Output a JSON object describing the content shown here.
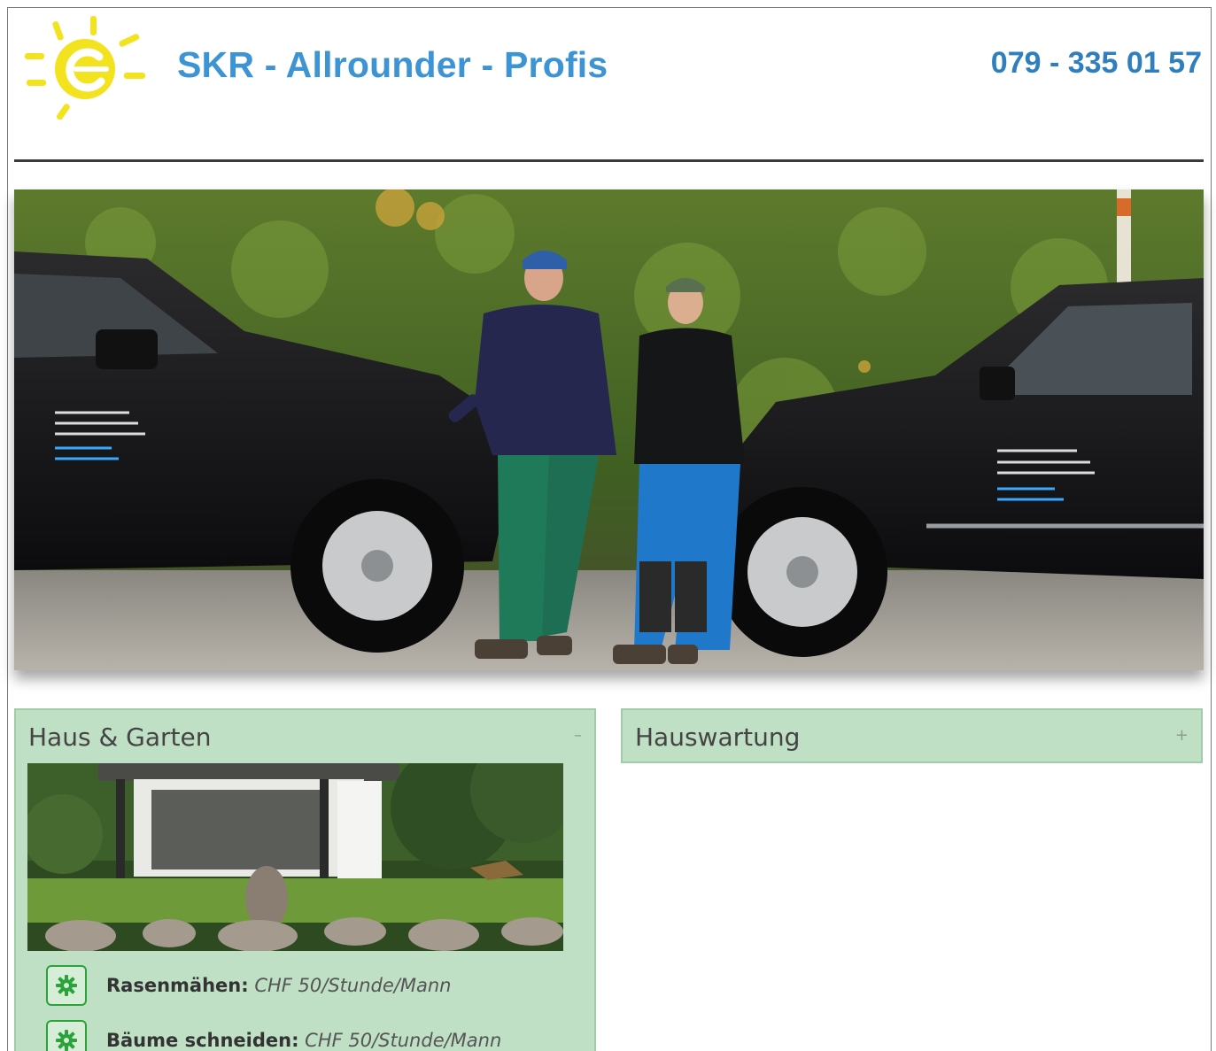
{
  "header": {
    "brand": "SKR - Allrounder - Profis",
    "phone": "079 - 335 01 57"
  },
  "panels": {
    "left": {
      "title": "Haus & Garten",
      "toggle": "–",
      "services": [
        {
          "name": "Rasenmähen:",
          "price": "CHF 50/Stunde/Mann",
          "icon": "gear-icon"
        },
        {
          "name": "Bäume schneiden:",
          "price": "CHF 50/Stunde/Mann",
          "icon": "gear-icon"
        }
      ]
    },
    "right": {
      "title": "Hauswartung",
      "toggle": "+"
    }
  },
  "colors": {
    "brand_blue": "#3d94d4",
    "panel_green": "#bfe0c4",
    "icon_green": "#2aa33a"
  }
}
